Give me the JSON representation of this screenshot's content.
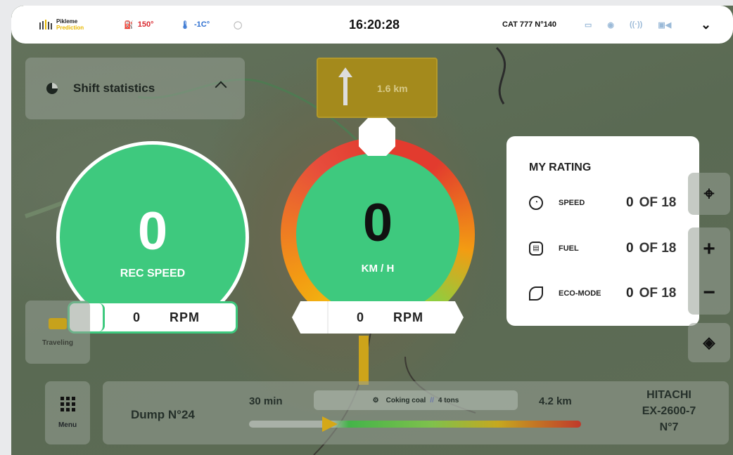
{
  "topbar": {
    "logo_line1": "Pikleme",
    "logo_line2": "Prediction",
    "engine_temp": "150°",
    "outside_temp": "-1C°",
    "clock": "16:20:28",
    "vehicle": "CAT 777 N°140",
    "icons": [
      "battery-icon",
      "location-icon",
      "signal-icon",
      "camera-icon"
    ]
  },
  "shift": {
    "label": "Shift statistics"
  },
  "navigation": {
    "distance": "1.6 km"
  },
  "rec_gauge": {
    "value": "0",
    "label": "REC SPEED",
    "rpm_value": "0",
    "rpm_unit": "RPM"
  },
  "speed_gauge": {
    "value": "0",
    "label": "KM / H",
    "rpm_value": "0",
    "rpm_unit": "RPM"
  },
  "rating": {
    "title": "MY RATING",
    "rows": [
      {
        "label": "SPEED",
        "value": "0",
        "of": "OF 18"
      },
      {
        "label": "FUEL",
        "value": "0",
        "of": "OF 18"
      },
      {
        "label": "ECO-MODE",
        "value": "0",
        "of": "OF 18"
      }
    ]
  },
  "tools": {
    "zoom_in": "+",
    "zoom_out": "−"
  },
  "traveling": {
    "label": "Traveling"
  },
  "menu": {
    "label": "Menu"
  },
  "route": {
    "destination": "Dump N°24",
    "time": "30 min",
    "cargo": "Coking coal",
    "cargo_weight": "4 tons",
    "distance": "4.2 km",
    "excavator_line1": "HITACHI",
    "excavator_line2": "EX-2600-7",
    "excavator_line3": "N°7",
    "progress": 0.2
  },
  "colors": {
    "gauge_green": "#3ec97e",
    "accent_yellow": "#d5a817",
    "alert_red": "#d9282f"
  }
}
